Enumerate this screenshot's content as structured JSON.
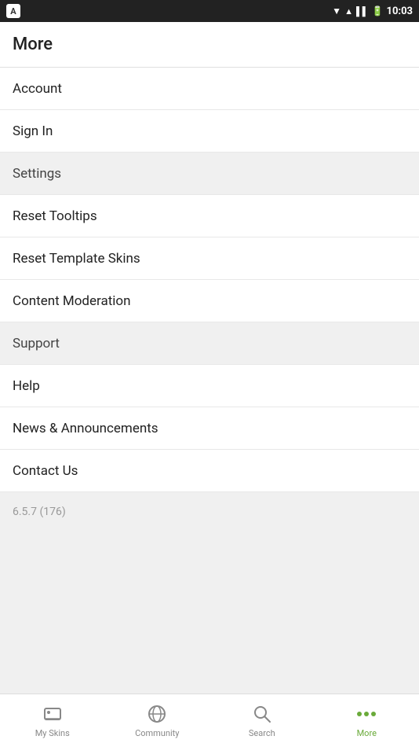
{
  "statusBar": {
    "time": "10:03"
  },
  "header": {
    "title": "More"
  },
  "menuItems": [
    {
      "id": "account",
      "label": "Account",
      "sectionBg": false
    },
    {
      "id": "sign-in",
      "label": "Sign In",
      "sectionBg": false
    },
    {
      "id": "settings",
      "label": "Settings",
      "sectionBg": true
    },
    {
      "id": "reset-tooltips",
      "label": "Reset Tooltips",
      "sectionBg": false
    },
    {
      "id": "reset-template-skins",
      "label": "Reset Template Skins",
      "sectionBg": false
    },
    {
      "id": "content-moderation",
      "label": "Content Moderation",
      "sectionBg": false
    },
    {
      "id": "support",
      "label": "Support",
      "sectionBg": true
    },
    {
      "id": "help",
      "label": "Help",
      "sectionBg": false
    },
    {
      "id": "news-announcements",
      "label": "News & Announcements",
      "sectionBg": false
    },
    {
      "id": "contact-us",
      "label": "Contact Us",
      "sectionBg": false
    }
  ],
  "version": "6.5.7 (176)",
  "bottomNav": {
    "items": [
      {
        "id": "my-skins",
        "label": "My Skins",
        "active": false
      },
      {
        "id": "community",
        "label": "Community",
        "active": false
      },
      {
        "id": "search",
        "label": "Search",
        "active": false
      },
      {
        "id": "more",
        "label": "More",
        "active": true
      }
    ]
  }
}
